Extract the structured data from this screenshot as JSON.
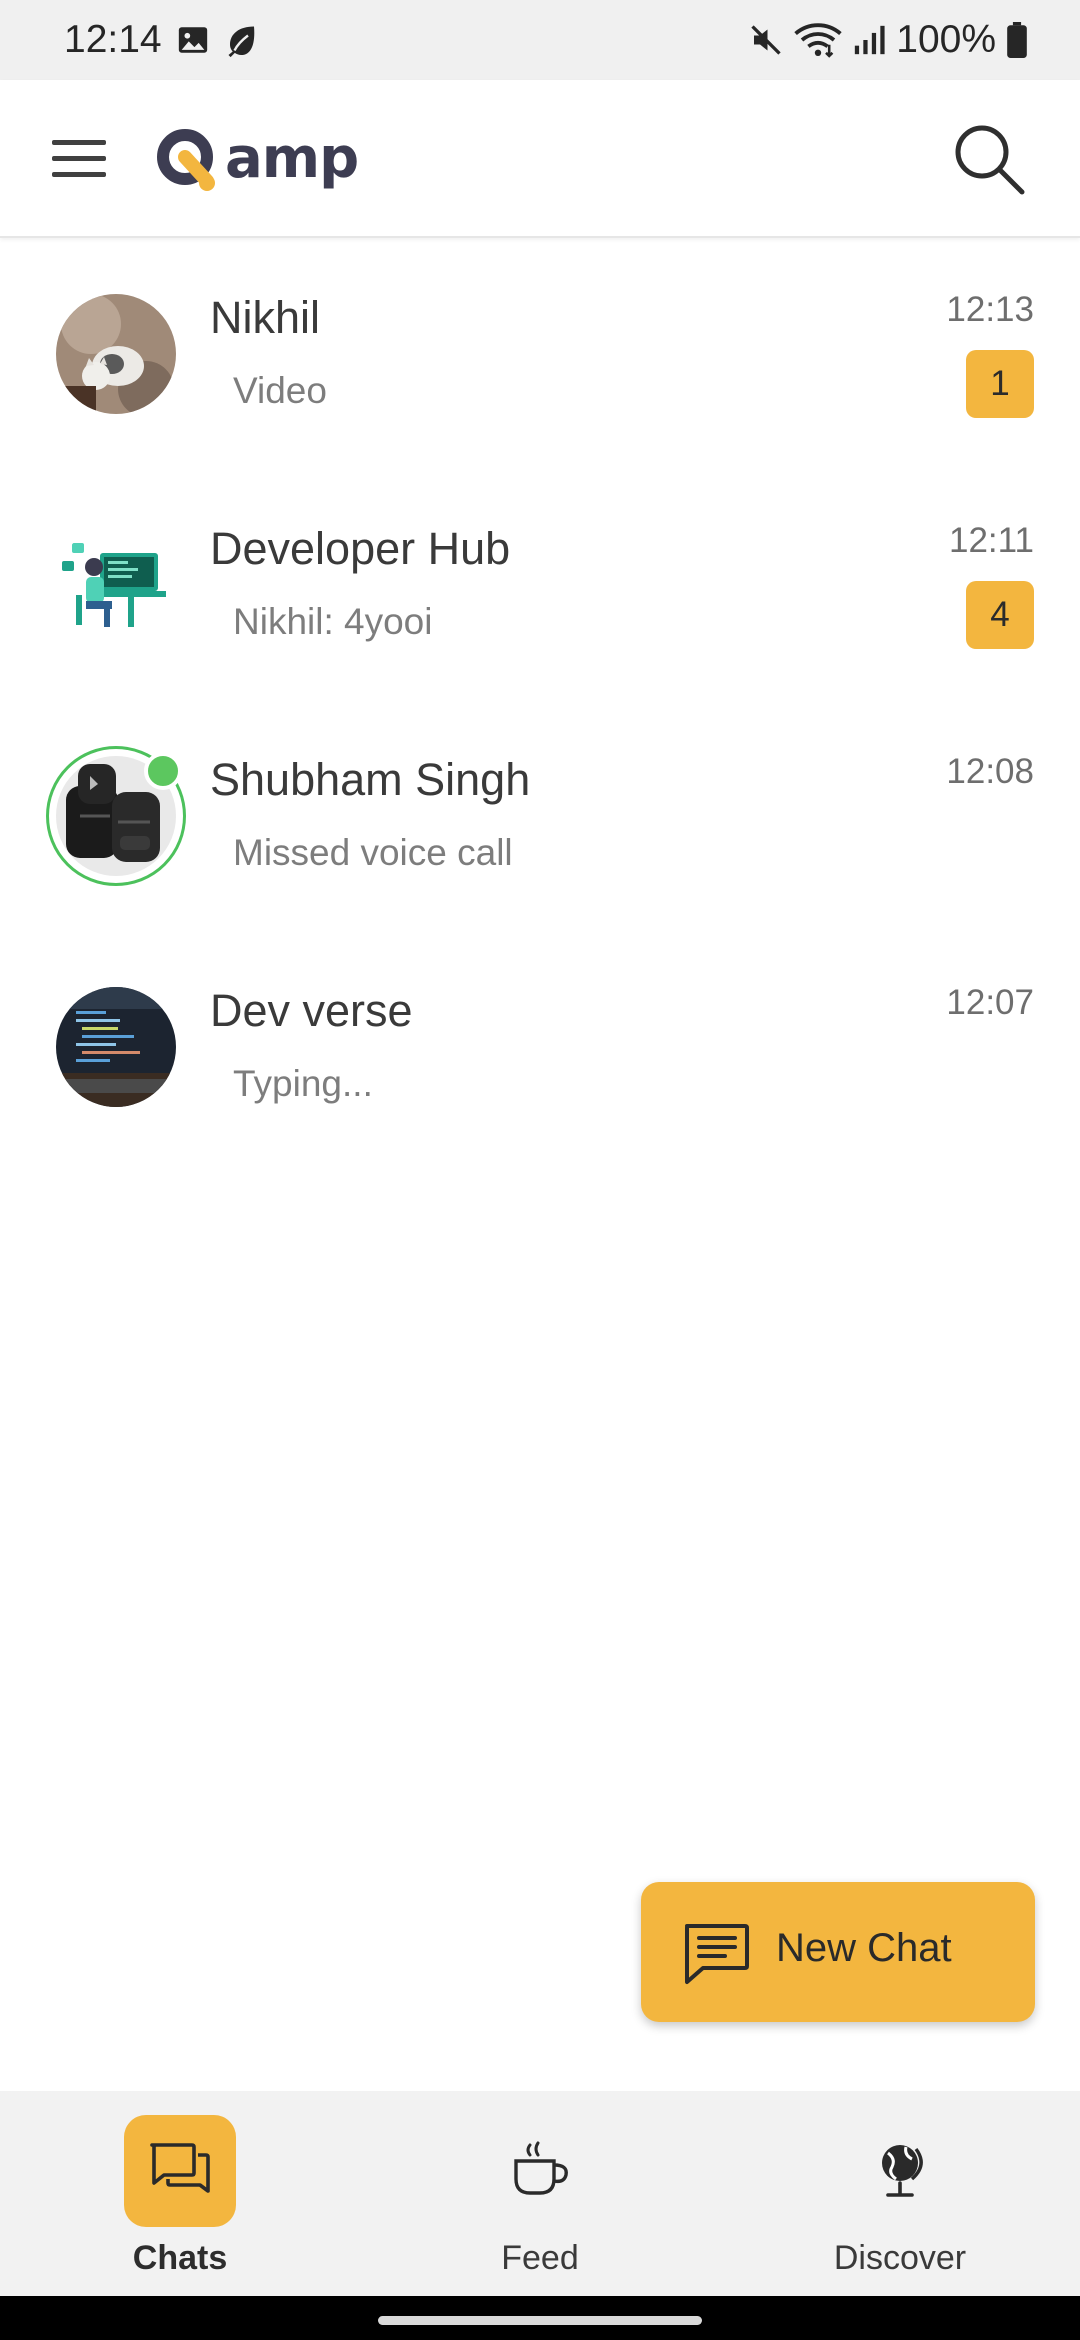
{
  "status_bar": {
    "time": "12:14",
    "battery": "100%",
    "icons": [
      "image-icon",
      "leaf-icon",
      "mute-icon",
      "wifi-icon",
      "signal-icon",
      "battery-icon"
    ]
  },
  "app_bar": {
    "logo_text": "amp",
    "logo_letter": "Q",
    "brand_color": "#f3b63f",
    "menu_icon": "hamburger-menu-icon",
    "search_icon": "search-icon"
  },
  "chats": [
    {
      "name": "Nikhil",
      "preview": "Video",
      "time": "12:13",
      "unread": "1",
      "online": false
    },
    {
      "name": "Developer Hub",
      "preview": "Nikhil: 4yooi",
      "time": "12:11",
      "unread": "4",
      "online": false
    },
    {
      "name": "Shubham Singh",
      "preview": "Missed voice call",
      "time": "12:08",
      "unread": "",
      "online": true
    },
    {
      "name": "Dev verse",
      "preview": "Typing...",
      "time": "12:07",
      "unread": "",
      "online": false
    }
  ],
  "fab": {
    "label": "New Chat",
    "icon": "chat-message-icon"
  },
  "bottom_nav": {
    "items": [
      {
        "label": "Chats",
        "icon": "chats-icon",
        "active": true
      },
      {
        "label": "Feed",
        "icon": "coffee-cup-icon",
        "active": false
      },
      {
        "label": "Discover",
        "icon": "globe-icon",
        "active": false
      }
    ]
  },
  "colors": {
    "accent": "#f3b63f",
    "online": "#5cc75f",
    "nav_bg": "#f2f2f2"
  }
}
